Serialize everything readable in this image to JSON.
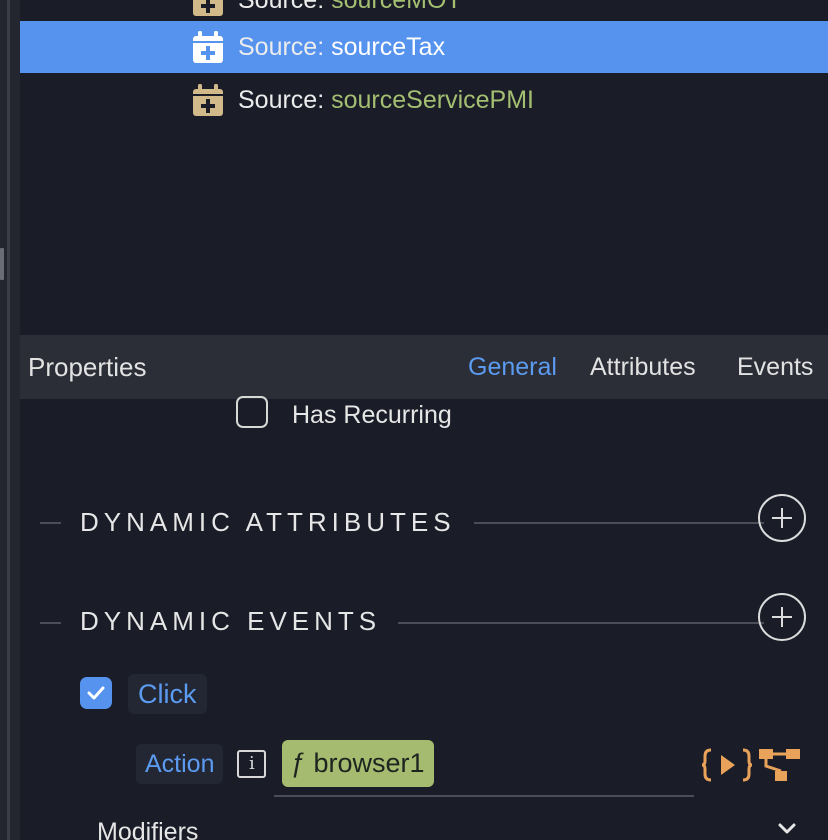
{
  "tree": {
    "items": [
      {
        "prefix": "Source:",
        "name": "sourceMOT",
        "selected": false
      },
      {
        "prefix": "Source:",
        "name": "sourceTax",
        "selected": true
      },
      {
        "prefix": "Source:",
        "name": "sourceServicePMI",
        "selected": false
      }
    ]
  },
  "properties": {
    "title": "Properties",
    "tabs": [
      {
        "label": "General",
        "active": true
      },
      {
        "label": "Attributes",
        "active": false
      },
      {
        "label": "Events",
        "active": false
      }
    ],
    "has_recurring": {
      "label": "Has Recurring",
      "checked": false
    },
    "dynamic_attributes": {
      "title": "DYNAMIC ATTRIBUTES"
    },
    "dynamic_events": {
      "title": "DYNAMIC EVENTS",
      "event": {
        "label": "Click",
        "checked": true
      },
      "action": {
        "label": "Action",
        "info": "i",
        "function": "ƒ browser1"
      },
      "modifiers_label": "Modifiers"
    }
  },
  "colors": {
    "accent": "#5593ef",
    "source_value": "#a4bf72",
    "function_pill": "#a5bb6f",
    "icon_orange": "#e8a25a",
    "calendar_icon": "#d2b98a"
  },
  "icons": {
    "tree_item": "calendar-plus-icon",
    "add": "plus-circle-icon",
    "info": "info-icon",
    "code": "code-braces-icon",
    "flow": "flow-diagram-icon",
    "expand": "chevron-down-icon"
  }
}
